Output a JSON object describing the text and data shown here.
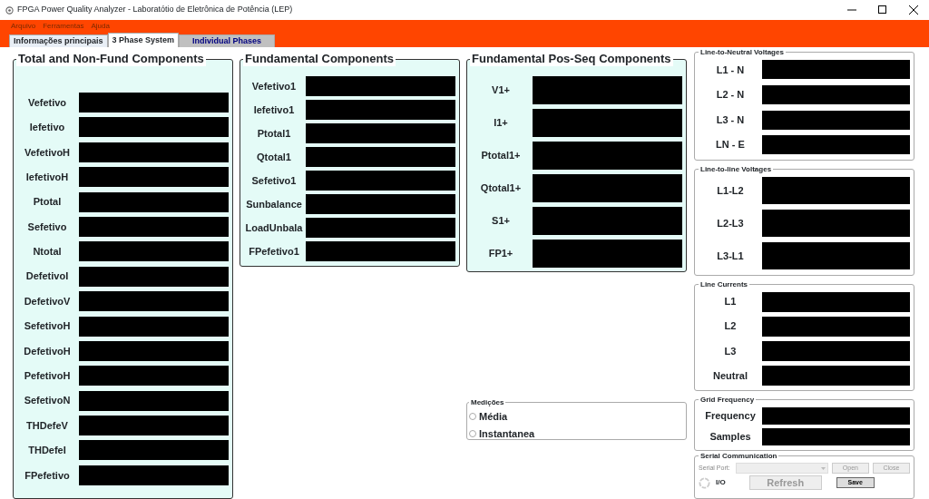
{
  "window": {
    "title": "FPGA Power Quality Analyzer - Laboratótio de Eletrônica de Potência (LEP)"
  },
  "menu": [
    "Arquivo",
    "Ferramentas",
    "Ajuda"
  ],
  "tabs": [
    {
      "label": "Informações principais",
      "selected": false
    },
    {
      "label": "3 Phase System",
      "selected": true
    },
    {
      "label": "Individual Phases",
      "selected": false
    }
  ],
  "panels": [
    {
      "title": "Total and Non-Fund Components",
      "rows": [
        "Vefetivo",
        "Iefetivo",
        "VefetivoH",
        "IefetivoH",
        "Ptotal",
        "Sefetivo",
        "Ntotal",
        "DefetivoI",
        "DefetivoV",
        "SefetivoH",
        "DefetivoH",
        "PefetivoH",
        "SefetivoN",
        "THDefeV",
        "THDefeI",
        "FPefetivo"
      ]
    },
    {
      "title": "Fundamental Components",
      "rows": [
        "Vefetivo1",
        "Iefetivo1",
        "Ptotal1",
        "Qtotal1",
        "Sefetivo1",
        "Sunbalance",
        "LoadUnbala",
        "FPefetivo1"
      ]
    },
    {
      "title": "Fundamental Pos-Seq Components",
      "rows": [
        "V1+",
        "I1+",
        "Ptotal1+",
        "Qtotal1+",
        "S1+",
        "FP1+"
      ]
    }
  ],
  "measurements": {
    "title": "Medições",
    "options": [
      {
        "label": "Média",
        "selected": false
      },
      {
        "label": "Instantanea",
        "selected": false
      }
    ]
  },
  "groups": [
    {
      "title": "Line-to-Neutral Voltages",
      "rows": [
        "L1 - N",
        "L2 - N",
        "L3 - N",
        "LN - E"
      ]
    },
    {
      "title": "Line-to-line Voltages",
      "rows": [
        "L1-L2",
        "L2-L3",
        "L3-L1"
      ]
    },
    {
      "title": "Line Currents",
      "rows": [
        "L1",
        "L2",
        "L3",
        "Neutral"
      ]
    },
    {
      "title": "Grid Frequency",
      "rows": [
        "Frequency",
        "Samples"
      ]
    }
  ],
  "serial": {
    "title": "Serial Communication",
    "port_label": "Serial Port:",
    "buttons": [
      {
        "label": "Open",
        "disabled": true
      },
      {
        "label": "Close",
        "disabled": true
      }
    ],
    "io_label": "I/O",
    "refresh": {
      "label": "Refresh",
      "disabled": true
    },
    "save": {
      "label": "Save",
      "disabled": false
    }
  }
}
